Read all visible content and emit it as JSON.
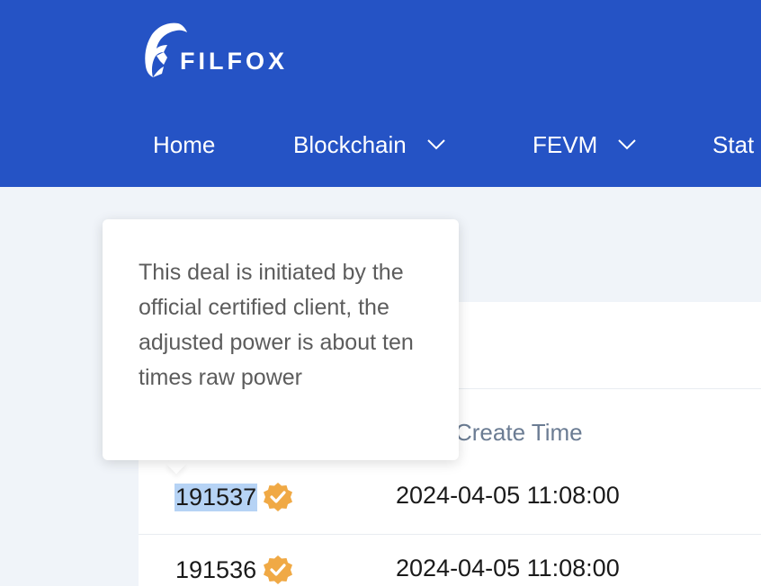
{
  "app": {
    "name": "FILFOX"
  },
  "colors": {
    "header_bg": "#2553c5",
    "badge": "#f0a945",
    "selection": "#b6d3f5"
  },
  "nav": {
    "items": [
      {
        "label": "Home",
        "has_dropdown": false
      },
      {
        "label": "Blockchain",
        "has_dropdown": true
      },
      {
        "label": "FEVM",
        "has_dropdown": true
      },
      {
        "label": "Stat",
        "has_dropdown": false
      }
    ]
  },
  "table": {
    "visible_column_header": "Create Time",
    "rows": [
      {
        "deal_id": "191537",
        "verified_icon": "verified-badge-icon",
        "create_time": "2024-04-05 11:08:00"
      },
      {
        "deal_id": "191536",
        "verified_icon": "verified-badge-icon",
        "create_time": "2024-04-05 11:08:00"
      }
    ]
  },
  "tooltip": {
    "text": "This deal is initiated by the official certified client, the adjusted power is about ten times raw power"
  }
}
